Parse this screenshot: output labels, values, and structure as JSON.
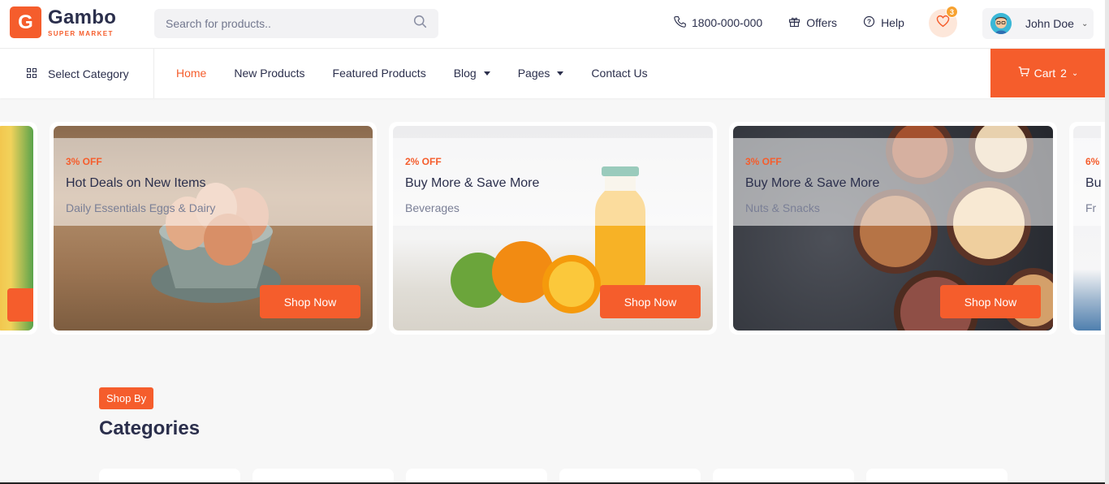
{
  "brand": {
    "logo_letter": "G",
    "name": "Gambo",
    "tagline": "SUPER MARKET",
    "accent": "#f55d2c"
  },
  "header": {
    "search_placeholder": "Search for products..",
    "phone": "1800-000-000",
    "offers_label": "Offers",
    "help_label": "Help",
    "wishlist_count": "3",
    "user_name": "John Doe"
  },
  "nav": {
    "select_category": "Select Category",
    "items": [
      {
        "label": "Home",
        "active": true
      },
      {
        "label": "New Products"
      },
      {
        "label": "Featured Products"
      },
      {
        "label": "Blog"
      },
      {
        "label": "Pages"
      },
      {
        "label": "Contact Us"
      }
    ],
    "cart_label": "Cart",
    "cart_count": "2"
  },
  "offers": [
    {
      "off": "3% OFF",
      "title": "Hot Deals on New Items",
      "subtitle": "Daily Essentials Eggs & Dairy",
      "button": "Shop Now"
    },
    {
      "off": "2% OFF",
      "title": "Buy More & Save More",
      "subtitle": "Beverages",
      "button": "Shop Now"
    },
    {
      "off": "3% OFF",
      "title": "Buy More & Save More",
      "subtitle": "Nuts & Snacks",
      "button": "Shop Now"
    },
    {
      "off": "6%",
      "title": "Bu",
      "subtitle": "Fr"
    }
  ],
  "section": {
    "badge": "Shop By",
    "title": "Categories"
  }
}
